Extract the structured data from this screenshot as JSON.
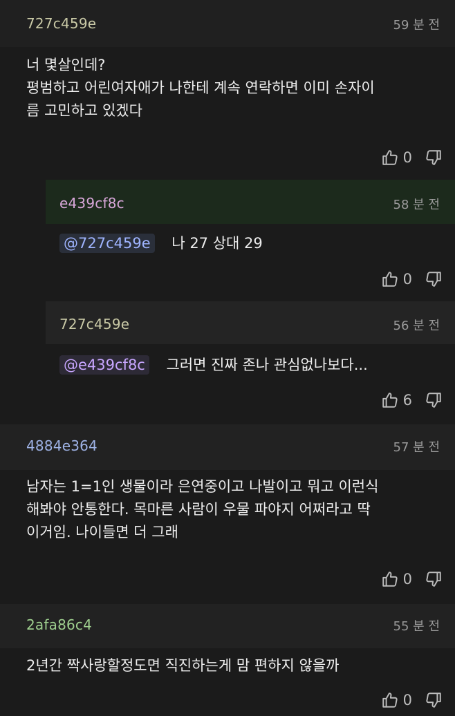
{
  "comments": [
    {
      "author": "727c459e",
      "time": "59 분 전",
      "text_lines": [
        "너 몇살인데?",
        "평범하고 어린여자애가 나한테 계속 연락하면 이미 손자이",
        "름 고민하고 있겠다"
      ],
      "likes": "0"
    },
    {
      "author": "e439cf8c",
      "time": "58 분 전",
      "mention": "@727c459e",
      "text": "나 27 상대 29",
      "likes": "0"
    },
    {
      "author": "727c459e",
      "time": "56 분 전",
      "mention": "@e439cf8c",
      "text": "그러면 진짜 존나 관심없나보다...",
      "likes": "6"
    },
    {
      "author": "4884e364",
      "time": "57 분 전",
      "text_lines": [
        "남자는 1=1인 생물이라 은연중이고 나발이고 뭐고 이런식",
        "해봐야 안통한다. 목마른 사람이 우물 파야지 어쩌라고 딱",
        "이거임. 나이들면 더 그래"
      ],
      "likes": "0"
    },
    {
      "author": "2afa86c4",
      "time": "55 분 전",
      "text_lines": [
        "2년간 짝사랑할정도면 직진하는게 맘 편하지 않을까"
      ],
      "likes": "0"
    }
  ],
  "colors": {
    "author_727c459e": "#c9c9a6",
    "author_e439cf8c": "#d7a6d8",
    "author_4884e364": "#9fb3e6",
    "author_2afa86c4": "#9fd08f",
    "header_bg_top": "#202020",
    "header_bg_reply1": "#1c2a1c",
    "header_bg_reply2": "#242424",
    "header_bg_c4": "#222222",
    "header_bg_c5": "#222222"
  },
  "icons": [
    "thumbs-up-icon",
    "thumbs-down-icon"
  ]
}
